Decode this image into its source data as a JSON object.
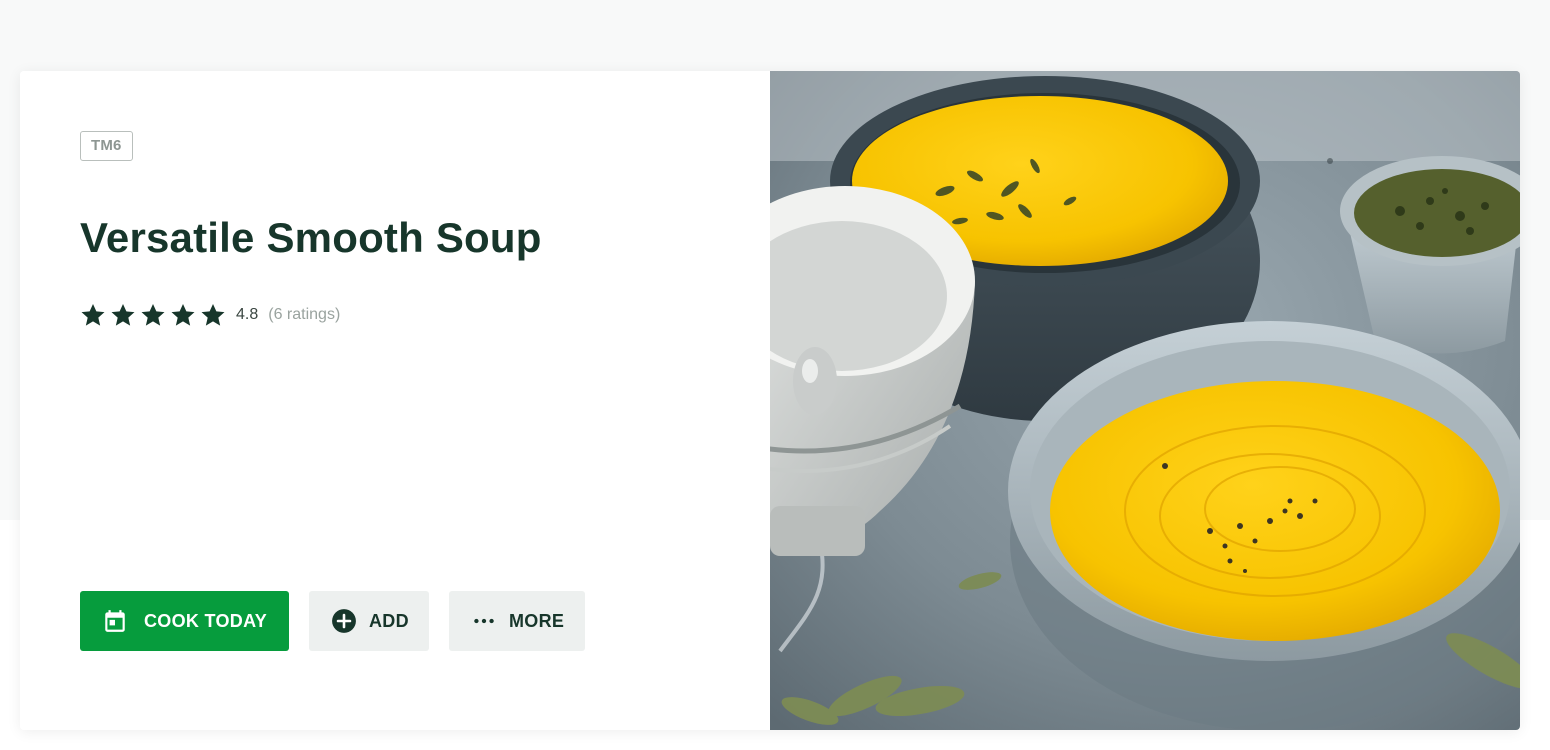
{
  "recipe": {
    "device_badge": "TM6",
    "title": "Versatile Smooth Soup",
    "rating": {
      "stars": 5,
      "value": "4.8",
      "count_label": "(6 ratings)"
    },
    "photo_alt": "Versatile Smooth Soup"
  },
  "actions": {
    "cook_today": "COOK TODAY",
    "add": "ADD",
    "more": "MORE"
  },
  "icons": {
    "calendar": "calendar-icon",
    "add": "plus-circle-icon",
    "more": "more-dots-icon",
    "star": "star-icon"
  },
  "colors": {
    "primary_green": "#069c3d",
    "title_dark_green": "#17362b",
    "secondary_button_bg": "#edf0ef",
    "soup_yellow": "#f5c000"
  }
}
